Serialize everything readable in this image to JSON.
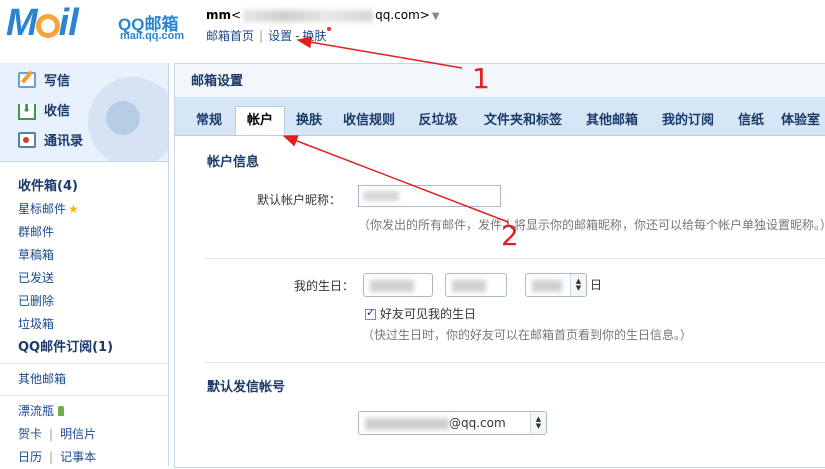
{
  "header": {
    "logo_main": "MOil",
    "logo_brand": "QQ邮箱",
    "logo_url": "mail.qq.com",
    "user_nick": "mm",
    "user_email_open": "<",
    "user_email_suffix": "qq.com>",
    "caret": "▼",
    "links": {
      "home": "邮箱首页",
      "separator": "|",
      "settings": "设置",
      "dash": "-",
      "skin": "换肤"
    }
  },
  "sidebar": {
    "quick": {
      "compose": "写信",
      "receive": "收信",
      "contacts": "通讯录"
    },
    "folders": {
      "inbox": "收件箱(4)",
      "starred": "星标邮件",
      "star_glyph": "★",
      "group": "群邮件",
      "drafts": "草稿箱",
      "sent": "已发送",
      "deleted": "已删除",
      "junk": "垃圾箱",
      "subscriptions": "QQ邮件订阅(1)",
      "other": "其他邮箱",
      "bottle": "漂流瓶",
      "cards": "贺卡",
      "postcards": "明信片",
      "calendar": "日历",
      "notes": "记事本",
      "sep": "|"
    }
  },
  "main": {
    "title": "邮箱设置",
    "tabs": [
      {
        "label": "常规"
      },
      {
        "label": "帐户"
      },
      {
        "label": "换肤"
      },
      {
        "label": "收信规则"
      },
      {
        "label": "反垃圾"
      },
      {
        "label": "文件夹和标签"
      },
      {
        "label": "其他邮箱"
      },
      {
        "label": "我的订阅"
      },
      {
        "label": "信纸"
      },
      {
        "label": "体验室"
      }
    ],
    "active_tab": "帐户",
    "account_info": {
      "section_title": "帐户信息",
      "nickname_label": "默认帐户昵称：",
      "nickname_hint": "（你发出的所有邮件，发件人将显示你的邮箱昵称，你还可以给每个帐户单独设置昵称。）",
      "birthday_label": "我的生日：",
      "birthday_unit": "日",
      "show_birthday": "好友可见我的生日",
      "show_birthday_checked": true,
      "birthday_hint": "（快过生日时，你的好友可以在邮箱首页看到你的生日信息。）"
    },
    "sender": {
      "section_title": "默认发信帐号",
      "email_suffix": "@qq.com"
    }
  },
  "annotations": {
    "num1": "1",
    "num2": "2",
    "color": "#e02020"
  },
  "colors": {
    "brand_blue": "#2a84cf",
    "tab_bar": "#d6e6f7",
    "link": "#1a4a8e"
  }
}
